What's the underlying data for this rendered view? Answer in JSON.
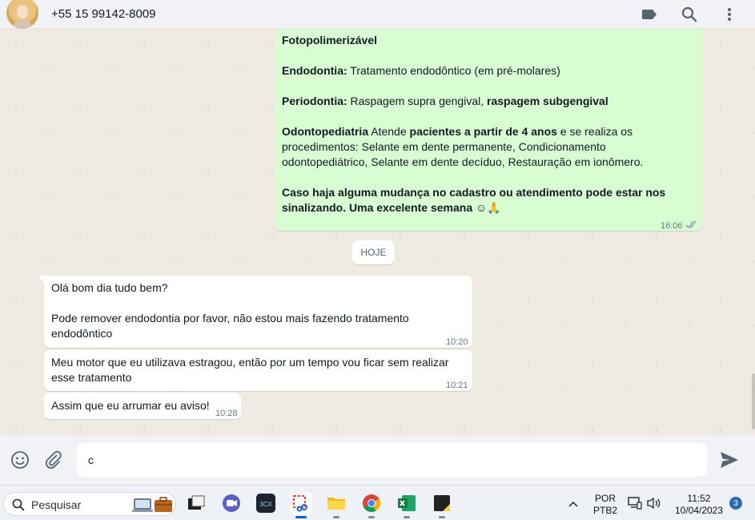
{
  "header": {
    "contact_name": "+55 15 99142-8009",
    "icons": [
      "label-icon",
      "search-icon",
      "menu-icon"
    ]
  },
  "messages": {
    "out_1": {
      "line_1": "Fotopolimerizável",
      "endo_label": "Endodontia:",
      "endo_text": " Tratamento endodôntico (em pré-molares)",
      "perio_label": "Periodontia:",
      "perio_text": " Raspagem supra gengival, ",
      "perio_bold": "raspagem subgengival",
      "odonto_label": "Odontopediatria",
      "odonto_text_1": " Atende ",
      "odonto_bold": "pacientes a partir de 4 anos",
      "odonto_text_2": " e se realiza os",
      "odonto_line_2": "procedimentos: Selante em dente permanente, Condicionamento",
      "odonto_line_3": "odontopediátrico, Selante em dente decíduo, Restauração em ionômero.",
      "closing_line_1": "Caso haja alguma mudança no cadastro ou atendimento pode estar nos",
      "closing_line_2": "sinalizando.  Uma excelente semana",
      "emoji": "☺🙏",
      "time": "16:06"
    },
    "day_separator": "HOJE",
    "in_1": {
      "line_1": "Olá bom dia tudo bem?",
      "line_2": "Pode remover endodontia por favor, não estou mais fazendo tratamento",
      "line_3": "endodôntico",
      "time": "10:20"
    },
    "in_2": {
      "line_1": "Meu motor que eu utilizava estragou, então por um tempo vou ficar sem realizar",
      "line_2": "esse tratamento",
      "time": "10:21"
    },
    "in_3": {
      "line_1": "Assim que eu arrumar eu aviso!",
      "time": "10:28"
    }
  },
  "composer": {
    "value": "c",
    "icons": [
      "emoji-icon",
      "attach-icon",
      "send-icon"
    ]
  },
  "taskbar": {
    "search_label": "Pesquisar",
    "apps": [
      "desktop-app-icon",
      "task-view-icon",
      "teams-icon",
      "3cx-icon",
      "snipping-tool-icon",
      "file-explorer-icon",
      "chrome-icon",
      "excel-icon",
      "sticky-notes-icon"
    ],
    "three_cx_label": "3CX",
    "language_line_1": "POR",
    "language_line_2": "PTB2",
    "clock_time": "11:52",
    "clock_date": "10/04/2023",
    "notification_count": "3"
  },
  "colors": {
    "outgoing_bubble": "#d9fdd3",
    "incoming_bubble": "#ffffff",
    "chat_background": "#efeae2",
    "read_ticks": "#8696a0"
  }
}
